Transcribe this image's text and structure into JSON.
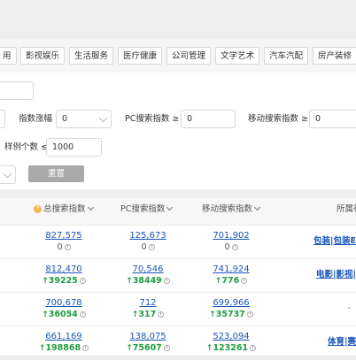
{
  "categories": [
    "用",
    "影视娱乐",
    "生活服务",
    "医疗健康",
    "公司管理",
    "文学艺术",
    "汽车汽配",
    "房产装修"
  ],
  "filters": {
    "zhishu_zhangfu_label": "指数涨幅",
    "zhishu_zhangfu_value": "0",
    "pc_label": "PC搜索指数 ≥",
    "pc_value": "0",
    "mobile_label": "移动搜索指数 ≥",
    "mobile_value": "0",
    "sample_label": "样例个数 ≤",
    "sample_value": "1000",
    "reset_label": "重置"
  },
  "table": {
    "headers": {
      "total": "总搜索指数",
      "pc": "PC搜索指数",
      "mobile": "移动搜索指数",
      "category": "所属行"
    },
    "rows": [
      {
        "total": "827,575",
        "total_chg": "0",
        "total_up": false,
        "pc": "125,673",
        "pc_chg": "0",
        "pc_up": false,
        "mobile": "701,902",
        "mobile_chg": "0",
        "mobile_up": false,
        "category": "包装|包装E"
      },
      {
        "total": "812,470",
        "total_chg": "39225",
        "total_up": true,
        "pc": "70,546",
        "pc_chg": "38449",
        "pc_up": true,
        "mobile": "741,924",
        "mobile_chg": "776",
        "mobile_up": true,
        "category": "电影|影视|"
      },
      {
        "total": "700,678",
        "total_chg": "36054",
        "total_up": true,
        "pc": "712",
        "pc_chg": "317",
        "pc_up": true,
        "mobile": "699,966",
        "mobile_chg": "35737",
        "mobile_up": true,
        "category": "-"
      },
      {
        "total": "661,169",
        "total_chg": "198868",
        "total_up": true,
        "pc": "138,075",
        "pc_chg": "75607",
        "pc_up": true,
        "mobile": "523,094",
        "mobile_chg": "123261",
        "mobile_up": true,
        "category": "体育|赛"
      }
    ]
  }
}
